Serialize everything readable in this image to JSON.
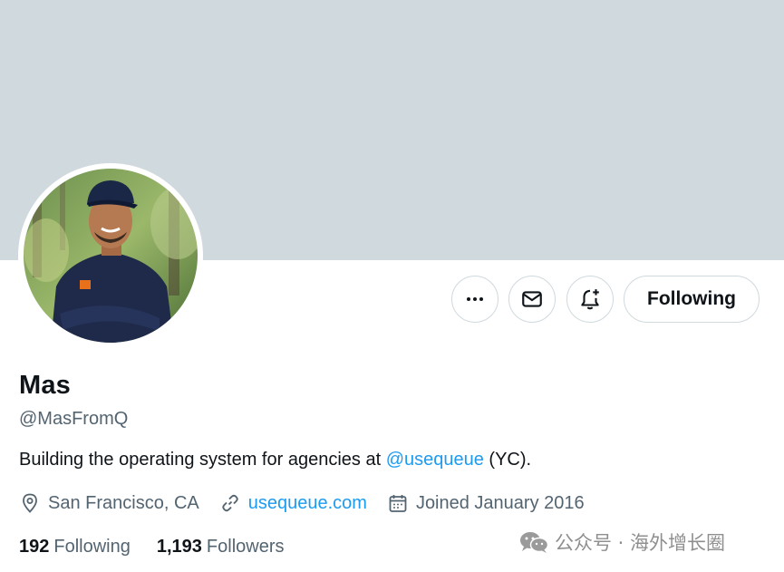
{
  "profile": {
    "name": "Mas",
    "handle": "@MasFromQ",
    "bio": {
      "prefix": "Building the operating system for agencies at ",
      "mention": "@usequeue",
      "suffix": " (YC)."
    },
    "location": "San Francisco, CA",
    "website": "usequeue.com",
    "joined": "Joined January 2016",
    "following_count": "192",
    "following_label": "Following",
    "followers_count": "1,193",
    "followers_label": "Followers"
  },
  "actions": {
    "more_icon": "more-icon",
    "message_icon": "mail-icon",
    "notify_icon": "bell-plus-icon",
    "following_button": "Following"
  },
  "watermark": {
    "text": "公众号 · 海外增长圈",
    "icon": "wechat-icon"
  },
  "colors": {
    "banner": "#cfd9de",
    "accent": "#1d9bf0",
    "text_primary": "#0f1419",
    "text_secondary": "#536471"
  }
}
